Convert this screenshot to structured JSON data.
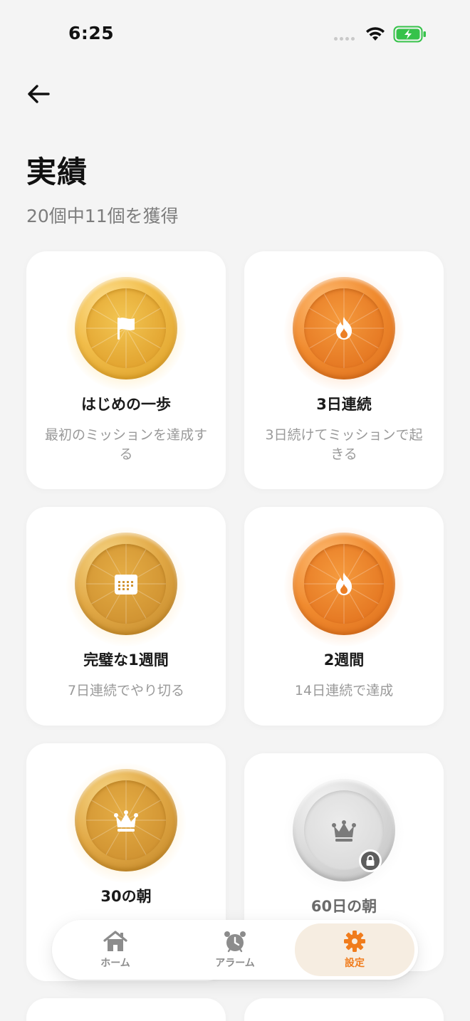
{
  "status": {
    "time": "6:25"
  },
  "header": {
    "title": "実績",
    "subtitle": "20個中11個を獲得"
  },
  "achievements": [
    {
      "title": "はじめの一歩",
      "desc": "最初のミッションを達成する",
      "icon": "flag-icon",
      "tier": "gold",
      "locked": false
    },
    {
      "title": "3日連続",
      "desc": "3日続けてミッションで起きる",
      "icon": "flame-icon",
      "tier": "orange",
      "locked": false
    },
    {
      "title": "完璧な1週間",
      "desc": "7日連続でやり切る",
      "icon": "calendar-icon",
      "tier": "goldDeep",
      "locked": false
    },
    {
      "title": "2週間",
      "desc": "14日連続で達成",
      "icon": "flame-icon",
      "tier": "orange",
      "locked": false
    },
    {
      "title": "30の朝",
      "desc": "",
      "icon": "crown-icon",
      "tier": "goldDeep",
      "locked": false
    },
    {
      "title": "60日の朝",
      "desc": "",
      "icon": "crown-icon",
      "tier": "silver",
      "locked": true
    }
  ],
  "tabs": [
    {
      "label": "ホーム",
      "icon": "home-icon",
      "active": false
    },
    {
      "label": "アラーム",
      "icon": "alarm-clock-icon",
      "active": false
    },
    {
      "label": "設定",
      "icon": "gear-icon",
      "active": true
    }
  ],
  "colors": {
    "accent": "#f07c1c",
    "gold": "#e9b13c",
    "orange": "#ec7f25",
    "silver": "#d5d5d5"
  }
}
